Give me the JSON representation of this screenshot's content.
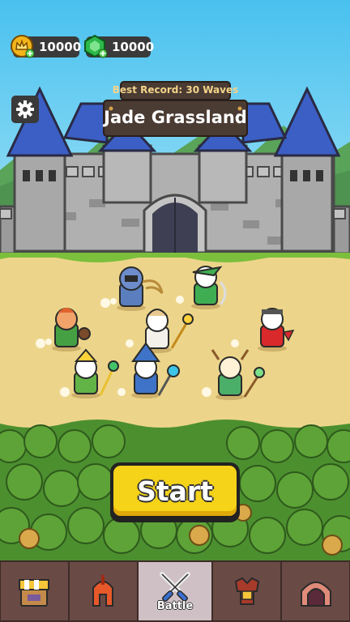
{
  "currency": {
    "gold": {
      "icon": "crown-coin-icon",
      "amount": "10000"
    },
    "gems": {
      "icon": "green-gem-icon",
      "amount": "10000"
    }
  },
  "stage": {
    "best_record_label": "Best Record:",
    "best_record_value": "30 Waves",
    "name": "Jade Grassland"
  },
  "start_button": {
    "label": "Start"
  },
  "nav": {
    "tabs": [
      {
        "id": "shop",
        "icon": "shop-stall-icon",
        "label": ""
      },
      {
        "id": "heroes",
        "icon": "spartan-helmet-icon",
        "label": ""
      },
      {
        "id": "battle",
        "icon": "crossed-swords-icon",
        "label": "Battle",
        "active": true
      },
      {
        "id": "equipment",
        "icon": "armor-icon",
        "label": ""
      },
      {
        "id": "dungeon",
        "icon": "cave-gate-icon",
        "label": ""
      }
    ]
  },
  "colors": {
    "accent_yellow": "#f5d319",
    "nav_bg": "#3d2b27",
    "nav_active": "#cfc0c6",
    "castle_roof": "#3b5fc4"
  }
}
